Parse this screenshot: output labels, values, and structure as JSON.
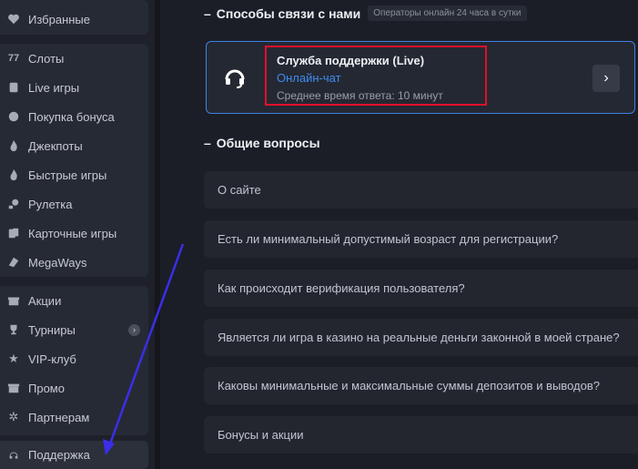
{
  "sidebar": {
    "favorites": {
      "label": "Избранные",
      "icon": "heart-icon"
    },
    "games": [
      {
        "label": "Слоты",
        "icon": "slots-icon"
      },
      {
        "label": "Live игры",
        "icon": "live-games-icon"
      },
      {
        "label": "Покупка бонуса",
        "icon": "bonus-buy-icon"
      },
      {
        "label": "Джекпоты",
        "icon": "flame-icon"
      },
      {
        "label": "Быстрые игры",
        "icon": "fire-icon"
      },
      {
        "label": "Рулетка",
        "icon": "roulette-icon"
      },
      {
        "label": "Карточные игры",
        "icon": "cards-icon"
      },
      {
        "label": "MegaWays",
        "icon": "megaways-icon"
      }
    ],
    "more": [
      {
        "label": "Акции",
        "icon": "gift-icon"
      },
      {
        "label": "Турниры",
        "icon": "trophy-icon"
      },
      {
        "label": "VIP-клуб",
        "icon": "star-icon"
      },
      {
        "label": "Промо",
        "icon": "promo-icon"
      },
      {
        "label": "Партнерам",
        "icon": "partners-icon"
      }
    ],
    "support": {
      "label": "Поддержка",
      "icon": "headset-icon"
    },
    "tournaments_badge": "›"
  },
  "contact": {
    "title": "Способы связи с нами",
    "operators_note": "Операторы онлайн 24 часа в сутки",
    "card": {
      "title": "Служба поддержки (Live)",
      "link": "Онлайн-чат",
      "response_time": "Среднее время ответа: 10 минут",
      "arrow": "›"
    }
  },
  "faq": {
    "title": "Общие вопросы",
    "items": [
      "О сайте",
      "Есть ли минимальный допустимый возраст для регистрации?",
      "Как происходит верификация пользователя?",
      "Является ли игра в казино на реальные деньги законной в моей стране?",
      "Каковы минимальные и максимальные суммы депозитов и выводов?",
      "Бонусы и акции"
    ]
  },
  "colors": {
    "accent": "#3f82e6",
    "highlight": "#e2102b",
    "annotation_arrow": "#3b2ee8"
  }
}
